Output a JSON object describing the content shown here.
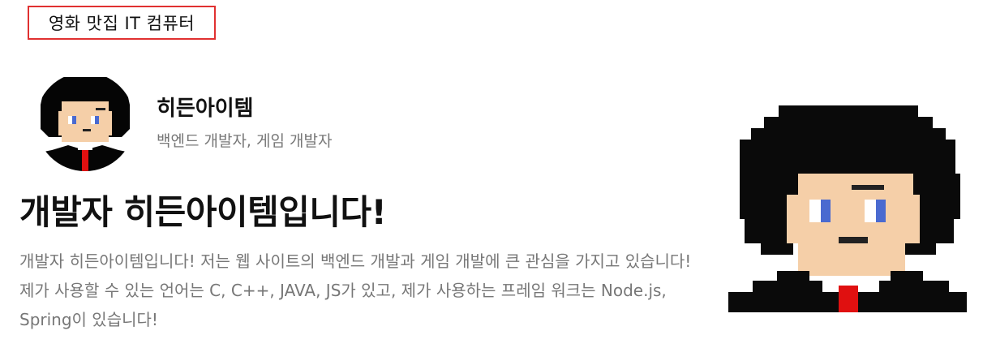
{
  "header": {
    "brand_label": "영화 맛집 IT 컴퓨터"
  },
  "profile": {
    "name": "히든아이템",
    "role": "백엔드 개발자, 게임 개발자"
  },
  "intro": {
    "headline": "개발자 히든아이템입니다!",
    "description": "개발자 히든아이템입니다! 저는 웹 사이트의 백엔드 개발과 게임 개발에 큰 관심을 가지고 있습니다! 제가 사용할 수 있는 언어는 C, C++, JAVA, JS가 있고, 제가 사용하는 프레임 워크는 Node.js, Spring이 있습니다!"
  },
  "colors": {
    "brand_border": "#e03131",
    "text_primary": "#111111",
    "text_secondary": "#777777",
    "hair": "#050505",
    "skin": "#f5cfa8",
    "eye": "#4a6ad0",
    "tie": "#e01010"
  },
  "icons": {
    "small_avatar": "pixel-character-avatar-icon",
    "large_avatar": "pixel-character-illustration"
  }
}
